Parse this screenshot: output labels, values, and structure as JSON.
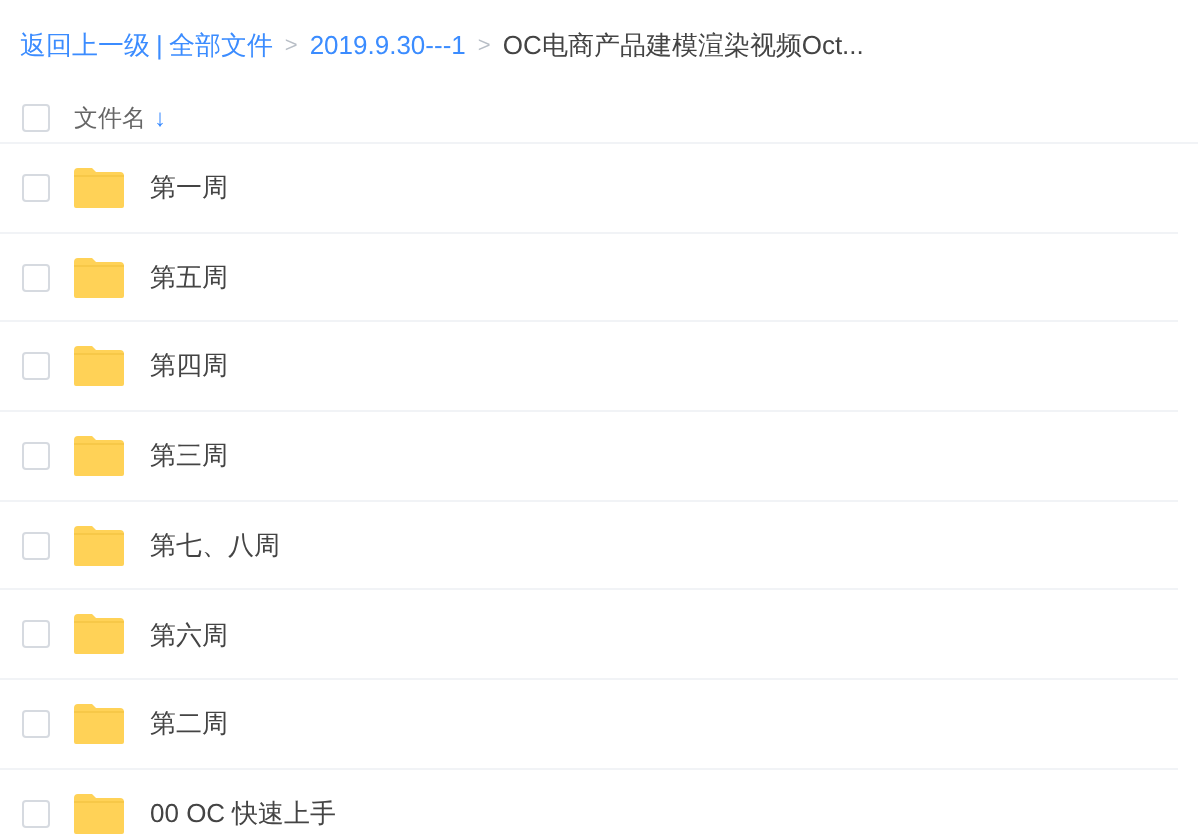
{
  "breadcrumb": {
    "back": "返回上一级",
    "separator": "|",
    "items": [
      {
        "label": "全部文件",
        "current": false
      },
      {
        "label": "2019.9.30---1",
        "current": false
      },
      {
        "label": "OC电商产品建模渲染视频Oct...",
        "current": true
      }
    ],
    "chevron": ">"
  },
  "header": {
    "checked": false,
    "label": "文件名",
    "sort_icon": "↓"
  },
  "files": [
    {
      "name": "第一周",
      "checked": false
    },
    {
      "name": "第五周",
      "checked": false
    },
    {
      "name": "第四周",
      "checked": false
    },
    {
      "name": "第三周",
      "checked": false
    },
    {
      "name": "第七、八周",
      "checked": false
    },
    {
      "name": "第六周",
      "checked": false
    },
    {
      "name": "第二周",
      "checked": false
    },
    {
      "name": "00 OC 快速上手",
      "checked": false
    }
  ]
}
